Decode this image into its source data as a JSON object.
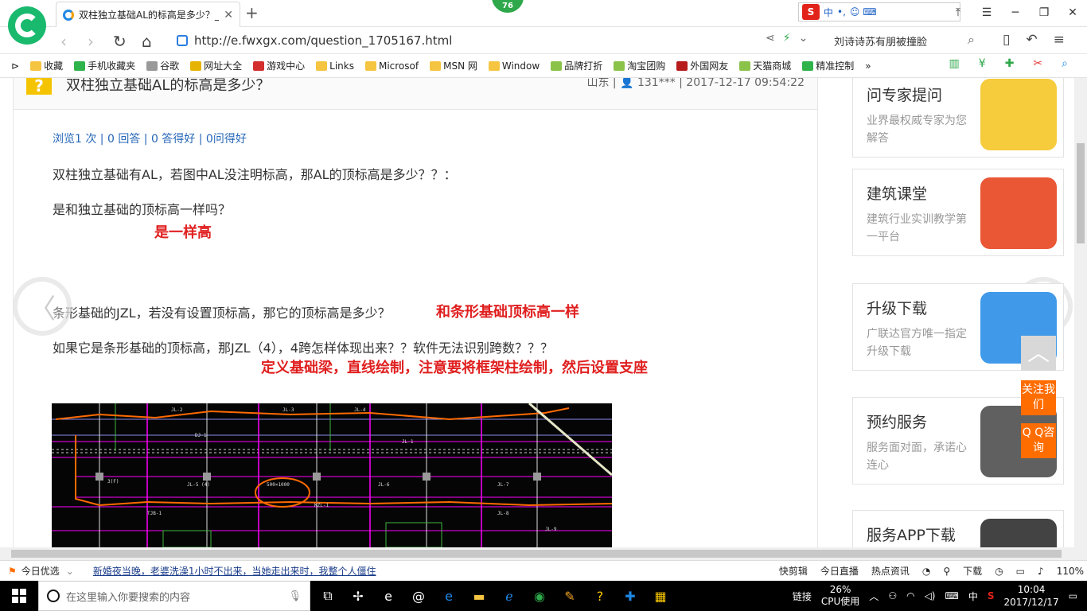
{
  "tab": {
    "title": "双柱独立基础AL的标高是多少？_",
    "close": "✕",
    "new": "+"
  },
  "badge": "76",
  "ime": {
    "logo": "S",
    "lang": "中",
    "punct": "•,",
    "icons": "☺ ⌨"
  },
  "window": {
    "minimize": "─",
    "maximize": "❐",
    "close": "✕",
    "menu": "☰",
    "shirt": "⤒"
  },
  "address": {
    "url": "http://e.fwxgx.com/question_1705167.html",
    "search_text": "刘诗诗苏有朋被撞脸"
  },
  "bookmarks": [
    {
      "label": "收藏",
      "color": "#f5c542"
    },
    {
      "label": "手机收藏夹",
      "color": "#2fb34a"
    },
    {
      "label": "谷歌",
      "color": "#999999"
    },
    {
      "label": "网址大全",
      "color": "#e6b400"
    },
    {
      "label": "游戏中心",
      "color": "#d32f2f"
    },
    {
      "label": "Links",
      "color": "#f5c542"
    },
    {
      "label": "Microsof",
      "color": "#f5c542"
    },
    {
      "label": "MSN 网",
      "color": "#f5c542"
    },
    {
      "label": "Window",
      "color": "#f5c542"
    },
    {
      "label": "品牌打折",
      "color": "#8bc34a"
    },
    {
      "label": "淘宝团购",
      "color": "#8bc34a"
    },
    {
      "label": "外国网友",
      "color": "#b71c1c"
    },
    {
      "label": "天猫商城",
      "color": "#8bc34a"
    },
    {
      "label": "精准控制",
      "color": "#2fb34a"
    }
  ],
  "question": {
    "icon": "?",
    "title": "双柱独立基础AL的标高是多少？",
    "meta": "山东 | 👤 131*** | 2017-12-17 09:54:22",
    "stats": "浏览1 次 | 0 回答 | 0 答得好 | 0问得好",
    "p1": "双柱独立基础有AL，若图中AL没注明标高，那AL的顶标高是多少？？：",
    "p2": "是和独立基础的顶标高一样吗？",
    "a1": "是一样高",
    "p3": "条形基础的JZL，若没有设置顶标高，那它的顶标高是多少？",
    "a2": "和条形基础顶标高一样",
    "p4": "如果它是条形基础的顶标高，那JZL（4），4跨怎样体现出来？？软件无法识别跨数？？？",
    "a3": "定义基础梁，直线绘制，注意要将框架柱绘制，然后设置支座"
  },
  "cad_labels": [
    "JL-2",
    "JL-3",
    "DJ-1",
    "JL-4",
    "JL-1",
    "3(F)",
    "JL-5 (4)",
    "500×1000",
    "JL-6",
    "JL-7",
    "TJB-1",
    "KZL-1",
    "JL-8",
    "JL-9"
  ],
  "sidebar": [
    {
      "title": "问专家提问",
      "desc": "业界最权威专家为您解答",
      "art": "#f4c21a"
    },
    {
      "title": "建筑课堂",
      "desc": "建筑行业实训教学第一平台",
      "art": "#e53912"
    },
    {
      "title": "升级下载",
      "desc": "广联达官方唯一指定升级下载",
      "art": "#1e88e5"
    },
    {
      "title": "预约服务",
      "desc": "服务面对面，承诺心连心",
      "art": "#444444"
    },
    {
      "title": "服务APP下载",
      "desc": "",
      "art": "#222222"
    }
  ],
  "float": {
    "top": "︿",
    "follow": "关注我们",
    "qq": "Q Q咨询"
  },
  "arrows": {
    "left": "〈",
    "right": "〉"
  },
  "status": {
    "today": "今日优选",
    "news": "新婚夜当晚，老婆洗澡1小时不出来，当她走出来时，我整个人僵住",
    "items": [
      "快剪辑",
      "今日直播",
      "热点资讯",
      "下载"
    ],
    "zoom": "110%"
  },
  "taskbar": {
    "search_placeholder": "在这里输入你要搜索的内容",
    "link": "链接",
    "cpu_pct": "26%",
    "cpu_label": "CPU使用",
    "ime": "中",
    "time": "10:04",
    "date": "2017/12/17"
  }
}
